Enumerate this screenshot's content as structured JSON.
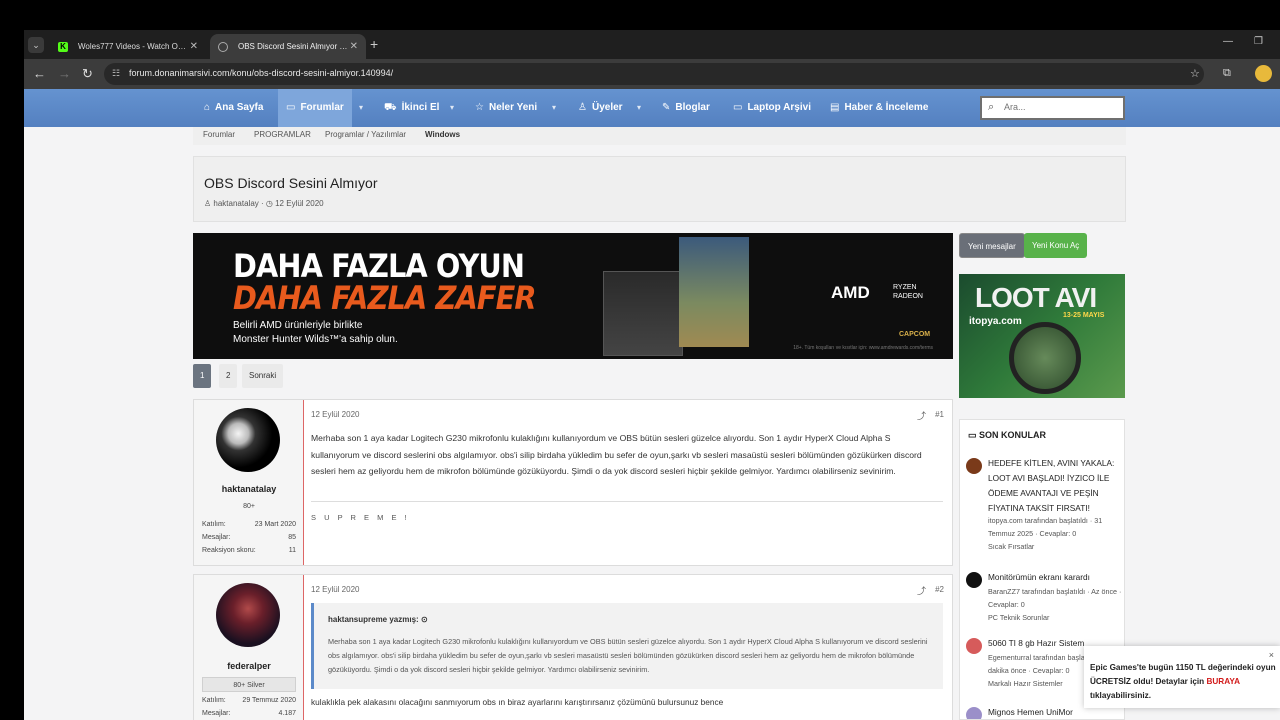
{
  "tabs": [
    {
      "title": "Woles777 Videos - Watch On-Demand",
      "active": false
    },
    {
      "title": "OBS Discord Sesini Almıyor | Donanım Arşivi",
      "active": true
    }
  ],
  "tab_menu_icon": "chevron-down-icon",
  "address_bar": {
    "url": "forum.donanimarsivi.com/konu/obs-discord-sesini-almiyor.140994/"
  },
  "nav": {
    "items": [
      {
        "label": "Ana Sayfa",
        "icon": "home-icon"
      },
      {
        "label": "Forumlar",
        "icon": "chat-icon",
        "active": true
      },
      {
        "label": "İkinci El",
        "icon": "cart-icon"
      },
      {
        "label": "Neler Yeni",
        "icon": "star-icon"
      },
      {
        "label": "Üyeler",
        "icon": "user-icon"
      },
      {
        "label": "Bloglar",
        "icon": "pen-icon"
      },
      {
        "label": "Laptop Arşivi",
        "icon": "laptop-icon"
      },
      {
        "label": "Haber & İnceleme",
        "icon": "news-icon"
      }
    ],
    "search_placeholder": "Ara..."
  },
  "breadcrumb": [
    "Forumlar",
    "PROGRAMLAR",
    "Programlar / Yazılımlar",
    "Windows"
  ],
  "thread": {
    "title": "OBS Discord Sesini Almıyor",
    "author": "haktanatalay",
    "date": "12 Eylül 2020"
  },
  "banner": {
    "line1": "DAHA FAZLA OYUN",
    "line2": "DAHA FAZLA ZAFER",
    "line3a": "Belirli AMD ürünleriyle birlikte",
    "line3b": "Monster Hunter Wilds™'a sahip olun.",
    "amd": "AMD",
    "radeon_a": "RYZEN",
    "radeon_b": "RADEON",
    "capcom": "CAPCOM",
    "fine": "18+. Tüm koşulları ve kısıtlar için: www.amdrewards.com/terms"
  },
  "buttons": {
    "new_messages": "Yeni mesajlar",
    "new_thread": "Yeni Konu Aç"
  },
  "side_ad": {
    "title": "LOOT AVI",
    "date": "13-25 MAYIS",
    "site": "itopya.com"
  },
  "pagination": {
    "pages": [
      "1",
      "2"
    ],
    "next": "Sonraki",
    "current": "1"
  },
  "posts": [
    {
      "date": "12 Eylül 2020",
      "number": "#1",
      "username": "haktanatalay",
      "badge": "80+",
      "stats": [
        {
          "label": "Katılım:",
          "value": "23 Mart 2020"
        },
        {
          "label": "Mesajlar:",
          "value": "85"
        },
        {
          "label": "Reaksiyon skoru:",
          "value": "11"
        }
      ],
      "body": "Merhaba son 1 aya kadar Logitech G230 mikrofonlu kulaklığını kullanıyordum ve OBS bütün sesleri güzelce alıyordu. Son 1 aydır HyperX Cloud Alpha S kullanıyorum ve discord seslerini obs algılamıyor. obs'i silip birdaha yükledim bu sefer de oyun,şarkı vb sesleri masaüstü sesleri bölümünden gözükürken discord sesleri hem az geliyordu hem de mikrofon bölümünde gözüküyordu. Şimdi o da yok discord sesleri hiçbir şekilde gelmiyor. Yardımcı olabilirseniz sevinirim.",
      "signature": "S U P R E M E !"
    },
    {
      "date": "12 Eylül 2020",
      "number": "#2",
      "username": "federalper",
      "badge": "80+ Silver",
      "stats": [
        {
          "label": "Katılım:",
          "value": "29 Temmuz 2020"
        },
        {
          "label": "Mesajlar:",
          "value": "4.187"
        }
      ],
      "quote_author": "haktansupreme yazmış:",
      "quote": "Merhaba son 1 aya kadar Logitech G230 mikrofonlu kulaklığını kullanıyordum ve OBS bütün sesleri güzelce alıyordu. Son 1 aydır HyperX Cloud Alpha S kullanıyorum ve discord seslerini obs algılamıyor. obs'i silip birdaha yükledim bu sefer de oyun,şarkı vb sesleri masaüstü sesleri bölümünden gözükürken discord sesleri hem az geliyordu hem de mikrofon bölümünde gözüküyordu. Şimdi o da yok discord sesleri hiçbir şekilde gelmiyor. Yardımcı olabilirseniz sevinirim.",
      "body": "kulaklıkla pek alakasını olacağını sanmıyorum obs ın biraz ayarlarını karıştırırsanız çözümünü bulursunuz bence"
    }
  ],
  "recent": {
    "heading": "SON KONULAR",
    "items": [
      {
        "title": "HEDEFE KİTLEN, AVINI YAKALA: LOOT AVI BAŞLADI! İYZICO İLE ÖDEME AVANTAJI VE PEŞİN FİYATINA TAKSİT FIRSATI!",
        "meta": "itopya.com tarafından başlatıldı · 31 Temmuz 2025 · Cevaplar: 0",
        "forum": "Sıcak Fırsatlar",
        "color": "#7a3a1a"
      },
      {
        "title": "Monitörümün ekranı karardı",
        "meta": "BaranZZ7 tarafından başlatıldı · Az önce · Cevaplar: 0",
        "forum": "PC Teknik Sorunlar",
        "color": "#111111"
      },
      {
        "title": "5060 TI 8 gb Hazır Sistem",
        "meta": "Egementurral tarafından başlatıldı · 1 dakika önce · Cevaplar: 0",
        "forum": "Markalı Hazır Sistemler",
        "color": "#d65b5b"
      },
      {
        "title": "Mignos Hemen UniMor",
        "meta": "",
        "forum": "",
        "color": "#9b8fc9"
      }
    ]
  },
  "toast": {
    "text_a": "Epic Games'te bugün 1150 TL değerindeki oyun ÜCRETSİZ oldu! Detaylar için ",
    "link": "BURAYA",
    "text_b": " tıklayabilirsiniz.",
    "close": "×"
  }
}
